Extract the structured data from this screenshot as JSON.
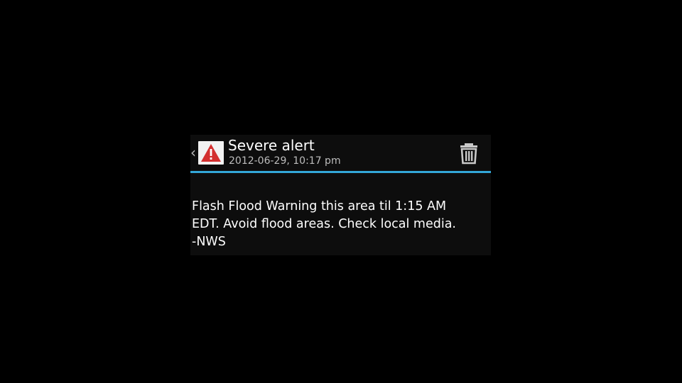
{
  "header": {
    "back_icon": "chevron-left-icon",
    "alert_icon": "warning-triangle-icon",
    "title": "Severe alert",
    "timestamp": "2012-06-29, 10:17 pm",
    "delete_icon": "trash-icon"
  },
  "message": {
    "body": "Flash Flood Warning this area til 1:15 AM\nEDT. Avoid flood areas. Check local media.\n-NWS"
  },
  "colors": {
    "background": "#000000",
    "accent_divider": "#33a7d8",
    "alert_red": "#d32f2f",
    "text_primary": "#ffffff",
    "text_secondary": "#bdbdbd"
  }
}
